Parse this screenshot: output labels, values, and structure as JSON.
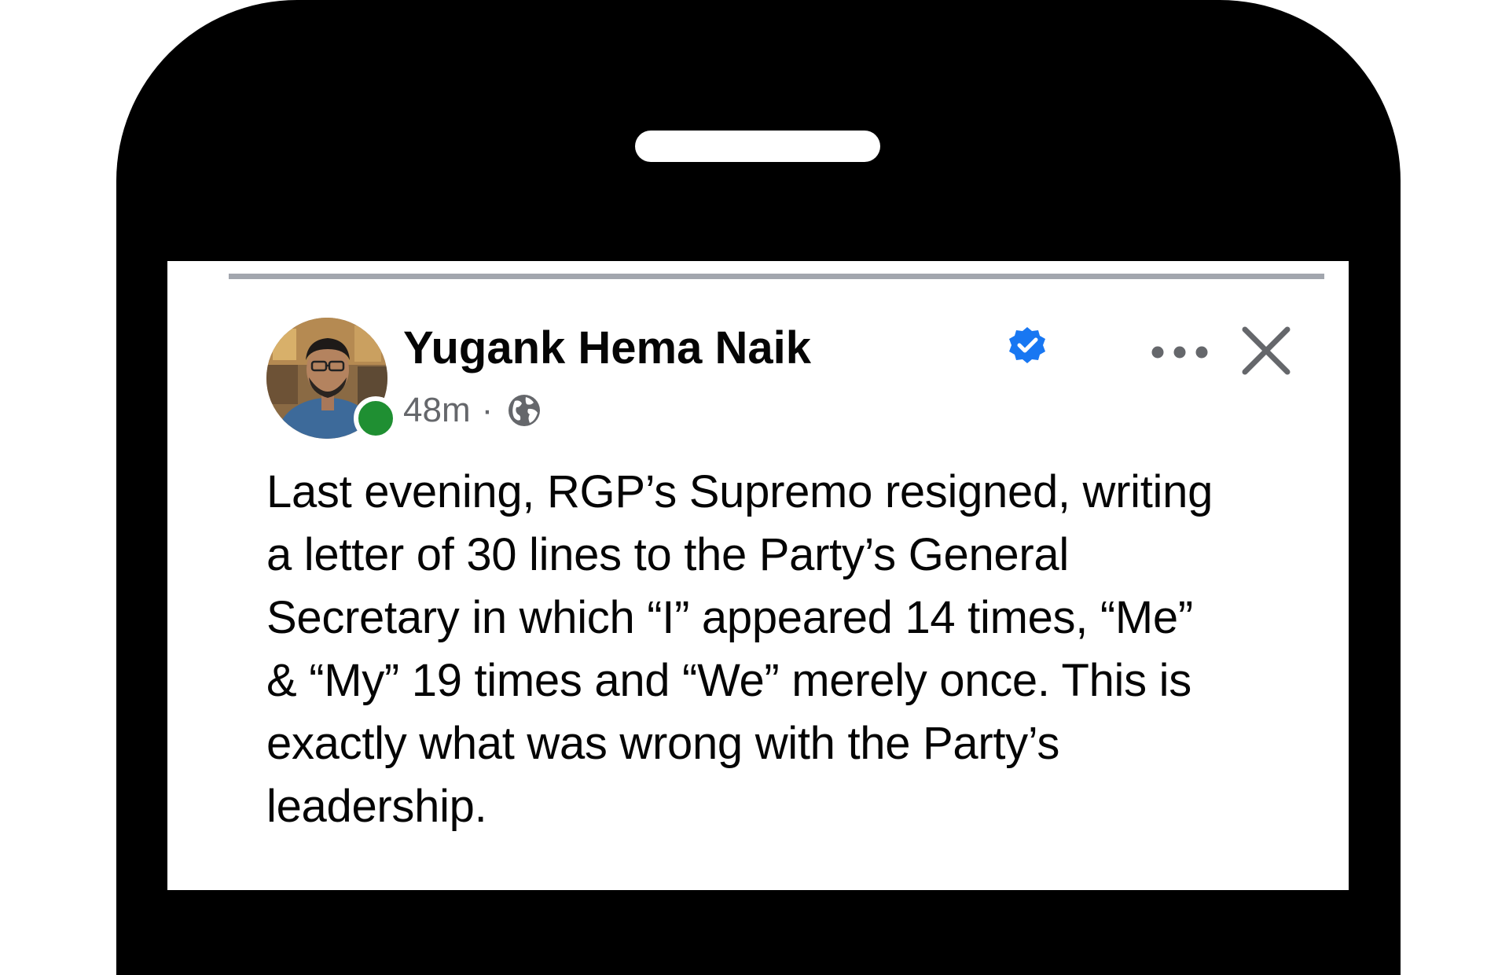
{
  "post": {
    "author_name": "Yugank Hema Naik",
    "verified": true,
    "timestamp": "48m",
    "separator": "·",
    "audience_icon": "globe-icon",
    "more_icon": "more-options-icon",
    "close_icon": "close-icon",
    "presence_status": "online",
    "body": "Last evening, RGP’s Supremo resigned, writing\na letter of 30 lines to the Party’s General\nSecretary in which “I” appeared 14 times, “Me”\n& “My” 19 times and “We” merely once. This is\nexactly what was wrong with the Party’s\nleadership."
  },
  "colors": {
    "verified_blue": "#1877f2",
    "presence_green": "#1f8f32",
    "meta_gray": "#65676b",
    "phone_frame": "#000000"
  }
}
